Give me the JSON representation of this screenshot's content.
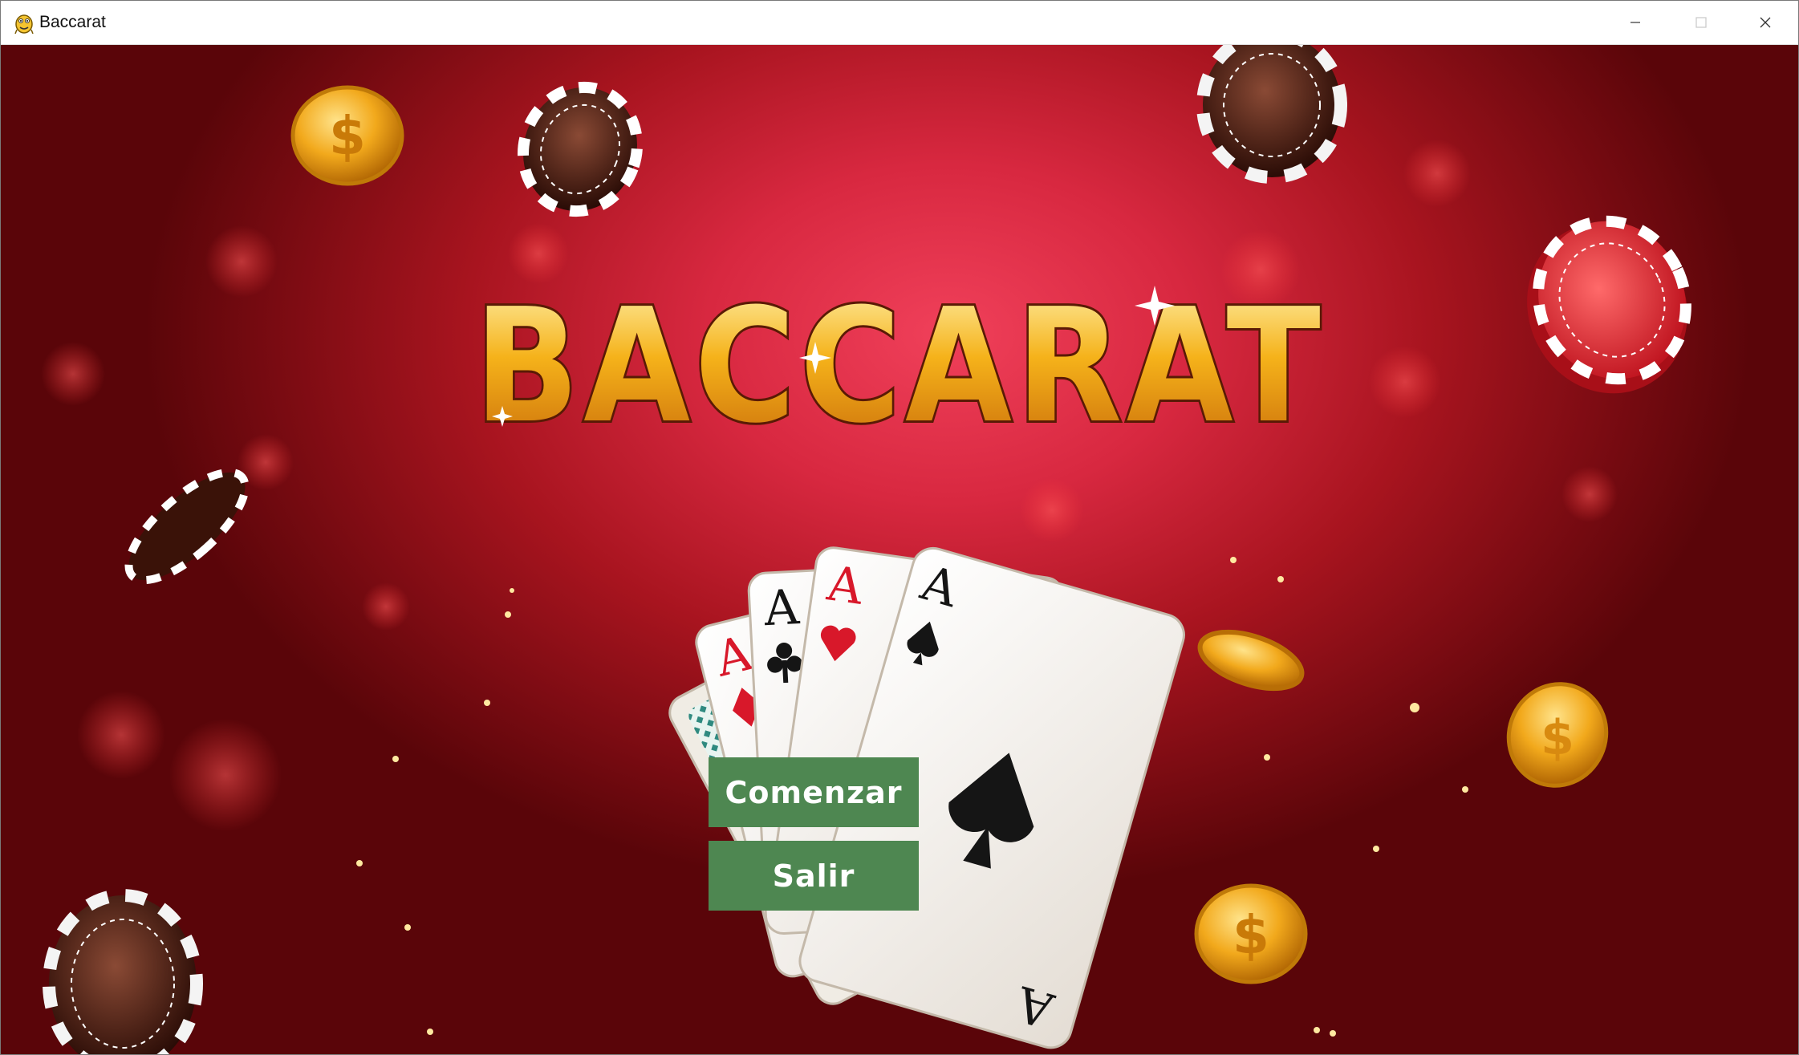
{
  "window": {
    "title": "Baccarat",
    "app_icon": "pygame-snake-icon",
    "controls": [
      "minimize-icon",
      "maximize-icon",
      "close-icon"
    ]
  },
  "game": {
    "title": "BACCARAT",
    "title_colors": {
      "top": "#fff3b0",
      "middle": "#f5b21a",
      "bottom": "#c86a0a",
      "outline": "#5a1a05"
    }
  },
  "menu": {
    "start_label": "Comenzar",
    "exit_label": "Salir",
    "button_color": "#4e8751"
  },
  "decorations": {
    "cards": [
      "A",
      "A",
      "A",
      "A"
    ],
    "card_suits": [
      "diamond",
      "club",
      "heart",
      "spade"
    ]
  }
}
